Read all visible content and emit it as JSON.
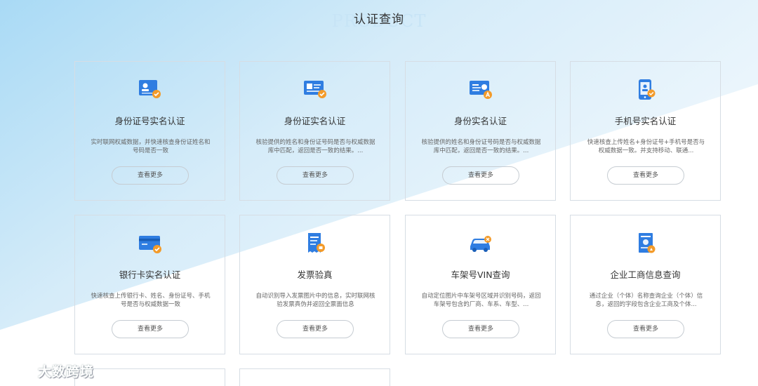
{
  "page": {
    "title_bg": "PRODUCT",
    "title": "认证查询"
  },
  "colors": {
    "accent_blue": "#2f7de1",
    "badge_orange": "#f39b2a",
    "background_gradient": "#bfe3f7"
  },
  "cards": [
    {
      "name": "身份证号实名认证",
      "desc": "实时联网权威数据，并快速核查身份证姓名和号码是否一致",
      "more": "查看更多",
      "icon": "id-card-check-icon"
    },
    {
      "name": "身份证实名认证",
      "desc": "核验提供的姓名和身份证号码是否与权威数据库中匹配，返回是否一致的结果。...",
      "more": "查看更多",
      "icon": "id-card-verify-icon"
    },
    {
      "name": "身份实名认证",
      "desc": "核验提供的姓名和身份证号码是否与权威数据库中匹配，返回是否一致的结果。...",
      "more": "查看更多",
      "icon": "identity-card-icon"
    },
    {
      "name": "手机号实名认证",
      "desc": "快速核查上传姓名+身份证号+手机号是否与权威数据一致。并支持移动、联通...",
      "more": "查看更多",
      "icon": "mobile-phone-icon"
    },
    {
      "name": "银行卡实名认证",
      "desc": "快速核查上传银行卡、姓名、身份证号、手机号是否与权威数据一致",
      "more": "查看更多",
      "icon": "bank-card-icon"
    },
    {
      "name": "发票验真",
      "desc": "自动识别导入发票图片中的信息，实时联网核验发票真伪并返回全票面信息",
      "more": "查看更多",
      "icon": "invoice-icon"
    },
    {
      "name": "车架号VIN查询",
      "desc": "自动定位图片中车架号区域并识别号码，返回车架号包含的厂商、车系、车型、...",
      "more": "查看更多",
      "icon": "car-icon"
    },
    {
      "name": "企业工商信息查询",
      "desc": "通过企业（个体）名称查询企业（个体）信息，返回的字段包含企业工商及个体...",
      "more": "查看更多",
      "icon": "business-license-icon"
    }
  ],
  "watermark": {
    "text": "大数跨境",
    "icon": "weibo-logo-icon"
  }
}
